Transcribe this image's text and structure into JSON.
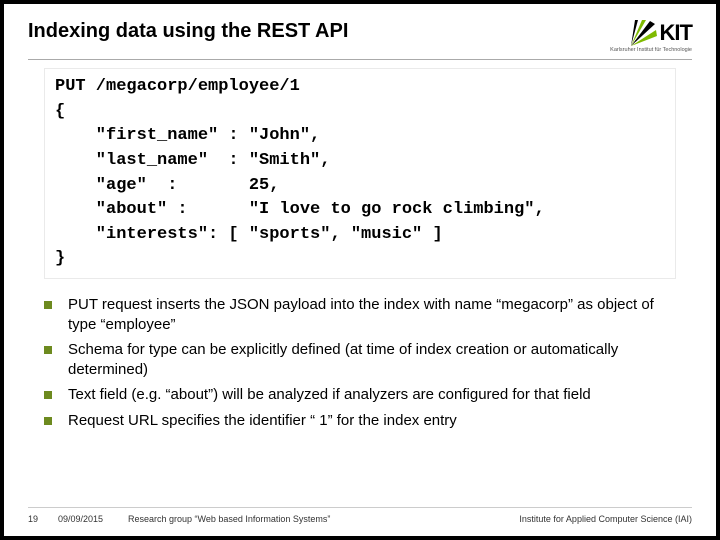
{
  "header": {
    "title": "Indexing data using the REST API",
    "logo_text": "KIT",
    "logo_sub": "Karlsruher Institut für Technologie"
  },
  "code": "PUT /megacorp/employee/1\n{\n    \"first_name\" : \"John\",\n    \"last_name\"  : \"Smith\",\n    \"age\"  :       25,\n    \"about\" :      \"I love to go rock climbing\",\n    \"interests\": [ \"sports\", \"music\" ]\n}",
  "bullets": [
    "PUT request inserts the JSON payload into the index with name “megacorp” as object of  type  “employee”",
    "Schema for type can be explicitly defined (at time of index creation or automatically determined)",
    "Text field (e.g. “about”) will be analyzed if analyzers are configured for that field",
    "Request URL specifies the identifier “ 1” for the index entry"
  ],
  "footer": {
    "page": "19",
    "date": "09/09/2015",
    "group": "Research group “Web based Information Systems”",
    "institute": "Institute for Applied Computer Science (IAI)"
  }
}
